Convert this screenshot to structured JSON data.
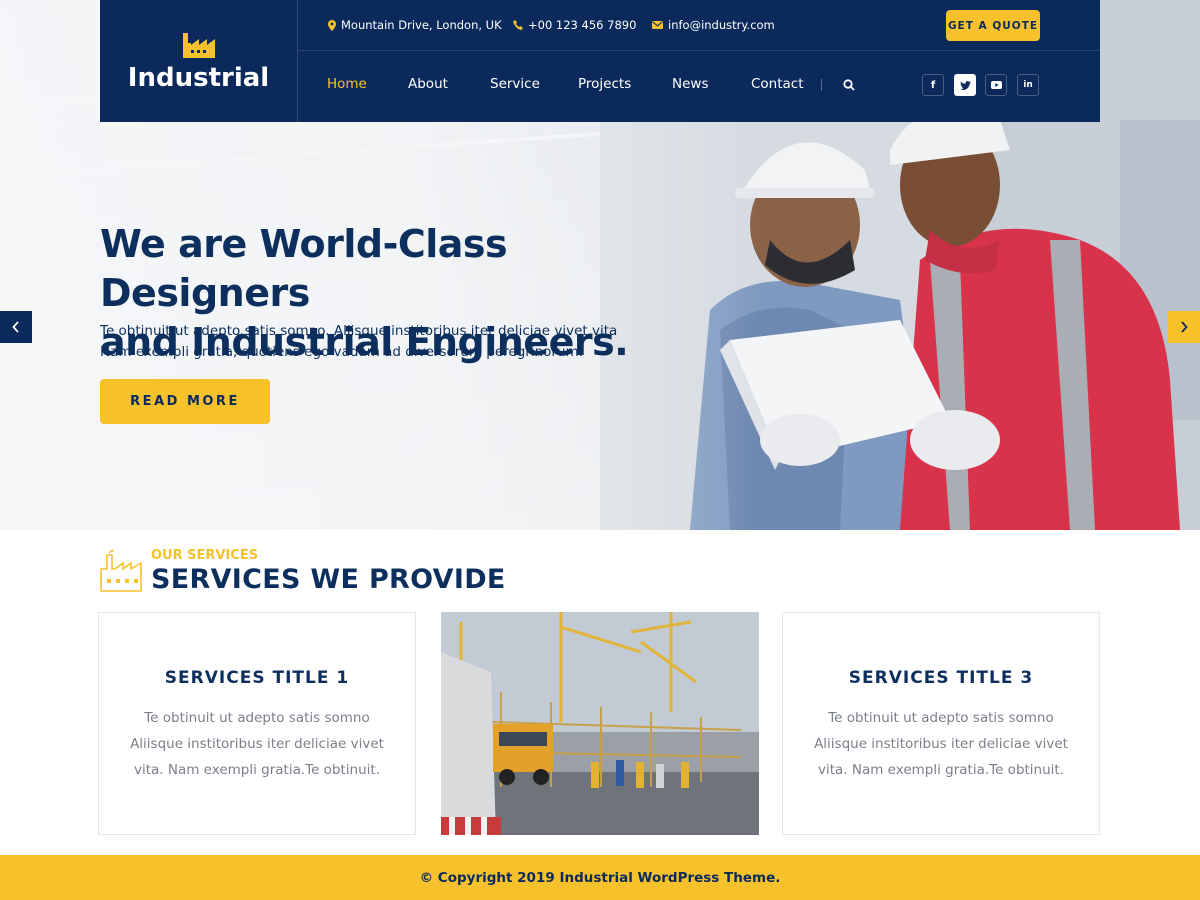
{
  "brand": {
    "name": "Industrial",
    "logo_icon": "factory-icon"
  },
  "topbar": {
    "address": "Mountain Drive, London, UK",
    "phone": "+00 123 456 7890",
    "email": "info@industry.com",
    "quote_label": "GET A QUOTE"
  },
  "nav": {
    "items": [
      {
        "label": "Home",
        "active": true
      },
      {
        "label": "About"
      },
      {
        "label": "Service"
      },
      {
        "label": "Projects"
      },
      {
        "label": "News"
      },
      {
        "label": "Contact"
      }
    ],
    "search_icon": "search-icon"
  },
  "social": [
    {
      "icon": "facebook-icon",
      "glyph": "f"
    },
    {
      "icon": "twitter-icon",
      "glyph": "t"
    },
    {
      "icon": "youtube-icon",
      "glyph": "▶"
    },
    {
      "icon": "linkedin-icon",
      "glyph": "in"
    }
  ],
  "hero": {
    "title_line1": "We are World-Class Designers",
    "title_line2": "and Industrial Engineers.",
    "text_line1": "Te obtinuit ut adepto satis somno. Aliisque institoribus iter deliciae vivet vita",
    "text_line2": "Nam exempli gratia, quotiens ego vadam ad diversorum peregrinorum.",
    "button": "READ MORE"
  },
  "services": {
    "small_heading": "OUR SERVICES",
    "heading": "SERVICES WE PROVIDE",
    "cards": [
      {
        "title": "SERVICES TITLE 1",
        "text": "Te obtinuit ut adepto satis somno Aliisque institoribus iter deliciae vivet vita. Nam exempli gratia.Te obtinuit."
      },
      {
        "title": "SERVICES TITLE 3",
        "text": "Te obtinuit ut adepto satis somno Aliisque institoribus iter deliciae vivet vita. Nam exempli gratia.Te obtinuit."
      }
    ]
  },
  "footer": {
    "copyright": "© Copyright 2019 Industrial WordPress Theme."
  },
  "colors": {
    "navy": "#0b2a5b",
    "accent": "#f6c12b",
    "muted_text": "#7a7f8a"
  }
}
